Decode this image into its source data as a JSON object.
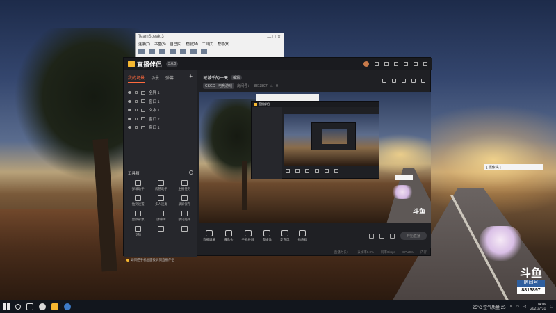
{
  "teamspeak": {
    "title": "TeamSpeak 3",
    "menu": [
      "连接(C)",
      "书签(B)",
      "自己(E)",
      "权限(M)",
      "工具(T)",
      "帮助(H)"
    ]
  },
  "app": {
    "name": "直播伴侣",
    "version_label": "3.6.0",
    "tabs": [
      "我的场景",
      "场景",
      "弹幕"
    ],
    "scenes": [
      {
        "label": "全屏 1"
      },
      {
        "label": "窗口 1"
      },
      {
        "label": "文本 1"
      },
      {
        "label": "窗口 2"
      },
      {
        "label": "窗口 1"
      }
    ],
    "tools_title": "工具箱",
    "tools": [
      {
        "label": "弹幕助手",
        "icon": "chat-icon"
      },
      {
        "label": "房管助手",
        "icon": "user-icon"
      },
      {
        "label": "主播任务",
        "icon": "task-icon"
      },
      {
        "label": "抽奖设置",
        "icon": "gift-icon"
      },
      {
        "label": "多人连麦",
        "icon": "download-icon"
      },
      {
        "label": "录屏保存",
        "icon": "record-icon"
      },
      {
        "label": "虚拟形象",
        "icon": "avatar-icon"
      },
      {
        "label": "弹幕库",
        "icon": "calendar-icon"
      },
      {
        "label": "歌词插件",
        "icon": "lyrics-icon"
      },
      {
        "label": "竞猜",
        "icon": "new-icon"
      },
      {
        "label": "",
        "icon": "more-icon"
      },
      {
        "label": "",
        "icon": "grid-icon"
      }
    ],
    "hint": "如何把手机画面投屏到直播伴侣",
    "room": {
      "title": "城城千的一天",
      "edit_label": "编辑",
      "category": "CSGO · 电竞游戏",
      "room_prefix": "房间号：",
      "room_id": "8813897",
      "hot": "0"
    },
    "bottom_tools": [
      {
        "label": "直播屏幕",
        "icon": "screen-icon"
      },
      {
        "label": "摄像头",
        "icon": "camera-icon"
      },
      {
        "label": "手机投屏",
        "icon": "phone-icon"
      },
      {
        "label": "多媒体",
        "icon": "media-icon"
      },
      {
        "label": "麦克风",
        "icon": "mic-icon"
      },
      {
        "label": "扬声器",
        "icon": "speaker-icon"
      }
    ],
    "start_live_label": "开始直播",
    "status": [
      "直播时长: --",
      "丢帧率0.0%",
      "码率0kbps",
      "CPU0%",
      "内存"
    ],
    "preview_brand": "斗鱼"
  },
  "desktop": {
    "cam_label": "[ 摄像头 ]",
    "brand_mark": "斗鱼",
    "room_label": "房间号",
    "room_number": "8813897"
  },
  "taskbar": {
    "weather": "25°C  空气质量 25",
    "time": "14:06",
    "date": "2021/7/31"
  }
}
